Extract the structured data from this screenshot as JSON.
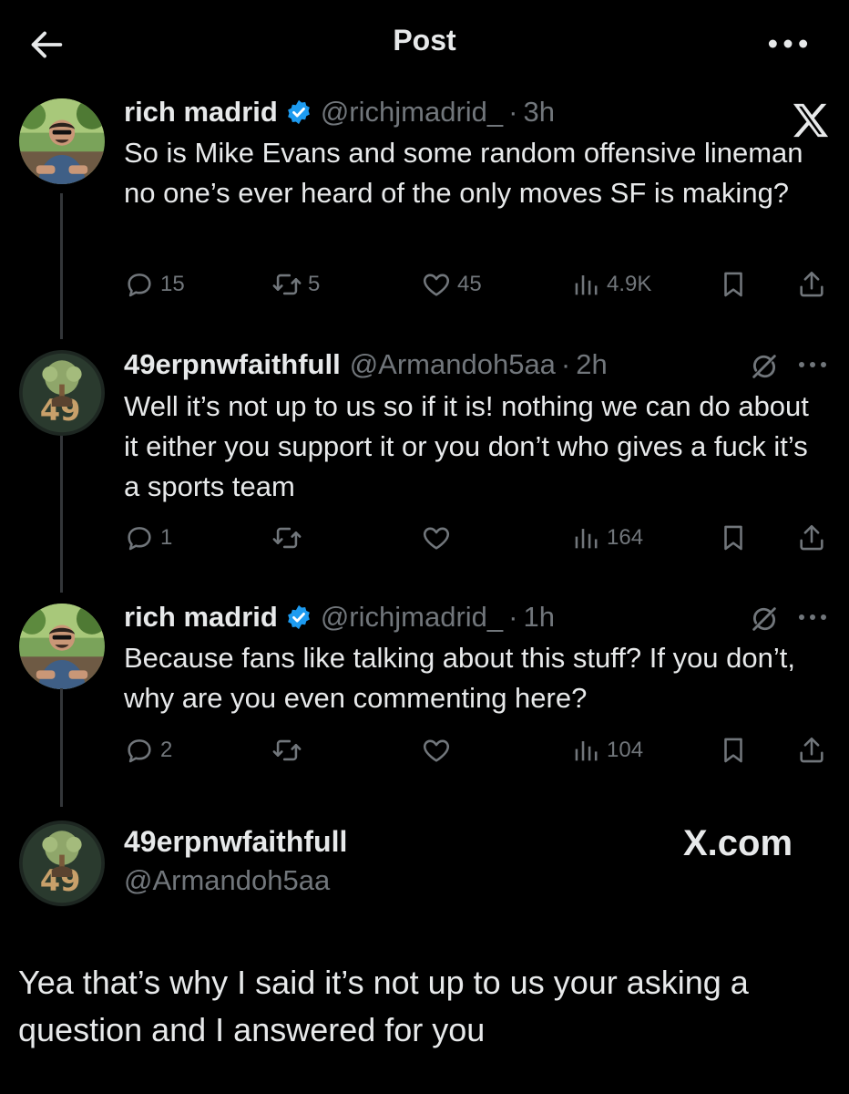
{
  "header": {
    "title": "Post"
  },
  "brand": {
    "xcom": "X.com"
  },
  "tweets": [
    {
      "name": "rich madrid",
      "handle": "@richjmadrid_",
      "time": "3h",
      "text": "So is Mike Evans and some random offensive lineman no one’s ever heard of the only moves SF is making?",
      "replies": "15",
      "reposts": "5",
      "likes": "45",
      "views": "4.9K"
    },
    {
      "name": "49erpnwfaithfull",
      "handle": "@Armandoh5aa",
      "time": "2h",
      "text": "Well it’s not up to us so if it is! nothing we can do about it either you support it or you don’t who gives a fuck it’s a sports team",
      "replies": "1",
      "reposts": "",
      "likes": "",
      "views": "164"
    },
    {
      "name": "rich madrid",
      "handle": "@richjmadrid_",
      "time": "1h",
      "text": "Because fans like talking about this stuff? If you don’t, why are you even commenting here?",
      "replies": "2",
      "reposts": "",
      "likes": "",
      "views": "104"
    }
  ],
  "reply_card": {
    "name": "49erpnwfaithfull",
    "handle": "@Armandoh5aa",
    "text": "Yea that’s why I said it’s not up to us your asking a question and I answered for you"
  },
  "colors": {
    "background": "#000000",
    "text": "#e7e9ea",
    "muted": "#71767b",
    "verified": "#1d9bf0",
    "thread_line": "#333639"
  },
  "icons": [
    "back-arrow-icon",
    "more-icon",
    "x-logo-icon",
    "verified-badge-icon",
    "reply-icon",
    "repost-icon",
    "like-icon",
    "views-icon",
    "bookmark-icon",
    "share-icon",
    "grok-icon"
  ]
}
